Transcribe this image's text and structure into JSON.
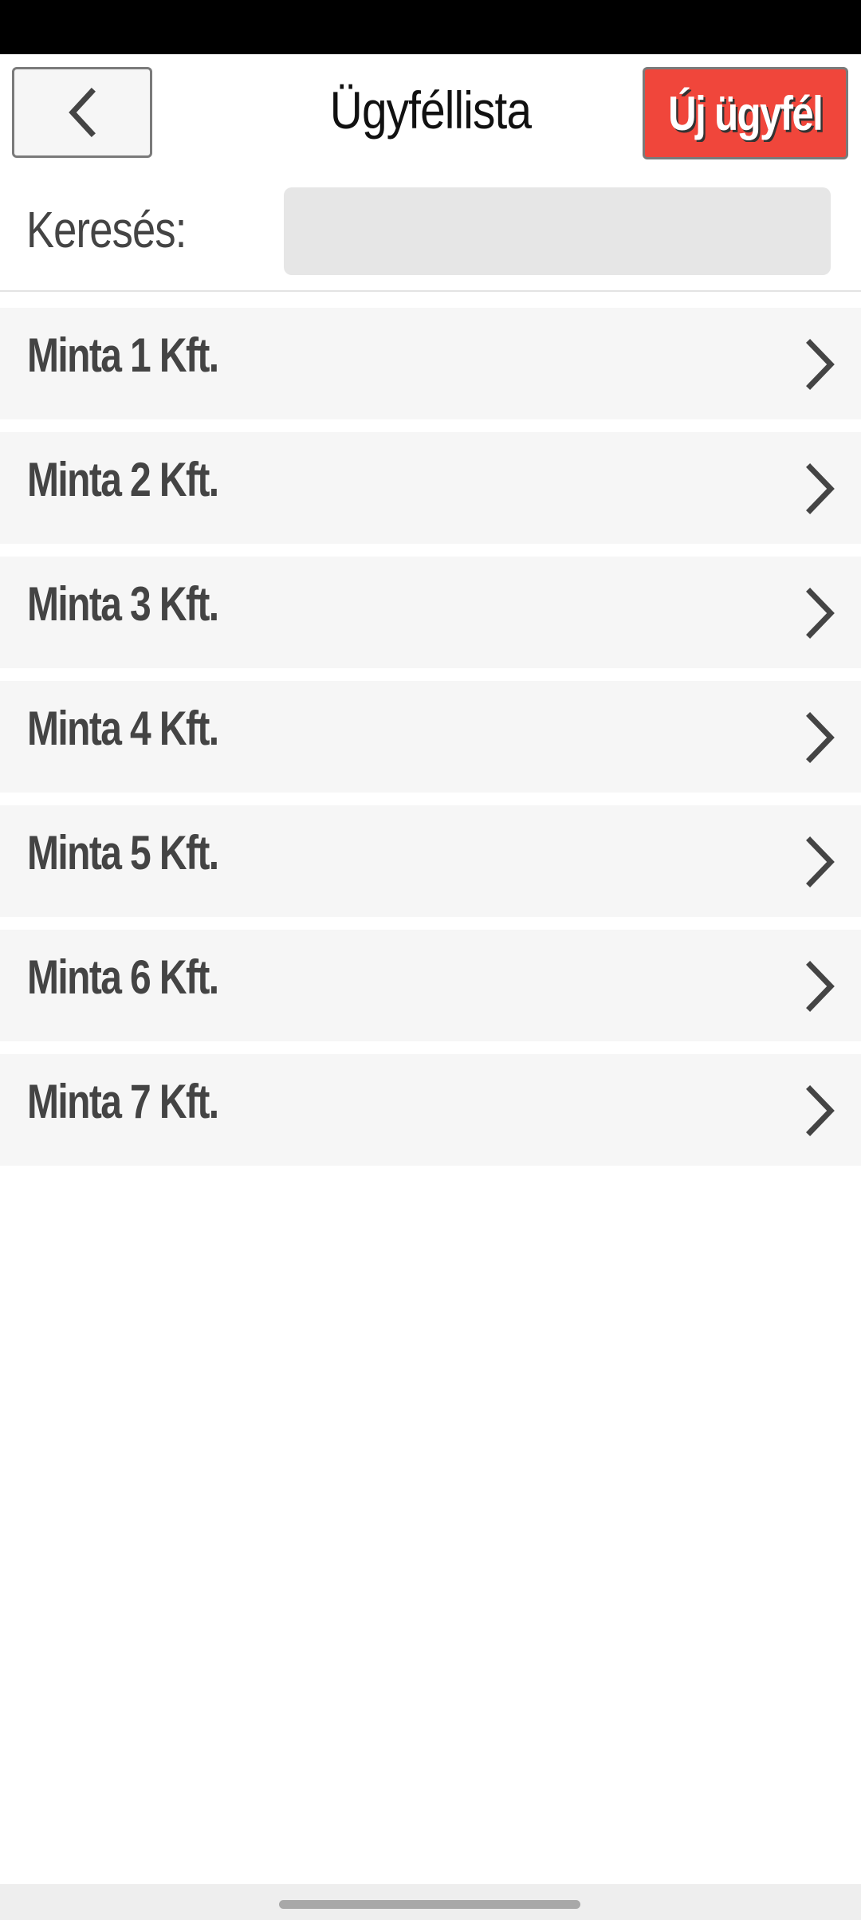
{
  "header": {
    "title": "Ügyféllista",
    "back_icon": "chevron-left-icon",
    "new_button_label": "Új ügyfél",
    "new_button_color": "#f0463b"
  },
  "search": {
    "label": "Keresés:",
    "value": "",
    "placeholder": ""
  },
  "clients": [
    {
      "name": "Minta 1 Kft.",
      "icon": "chevron-right-icon"
    },
    {
      "name": "Minta 2 Kft.",
      "icon": "chevron-right-icon"
    },
    {
      "name": "Minta 3 Kft.",
      "icon": "chevron-right-icon"
    },
    {
      "name": "Minta 4 Kft.",
      "icon": "chevron-right-icon"
    },
    {
      "name": "Minta 5 Kft.",
      "icon": "chevron-right-icon"
    },
    {
      "name": "Minta 6 Kft.",
      "icon": "chevron-right-icon"
    },
    {
      "name": "Minta 7 Kft.",
      "icon": "chevron-right-icon"
    }
  ]
}
